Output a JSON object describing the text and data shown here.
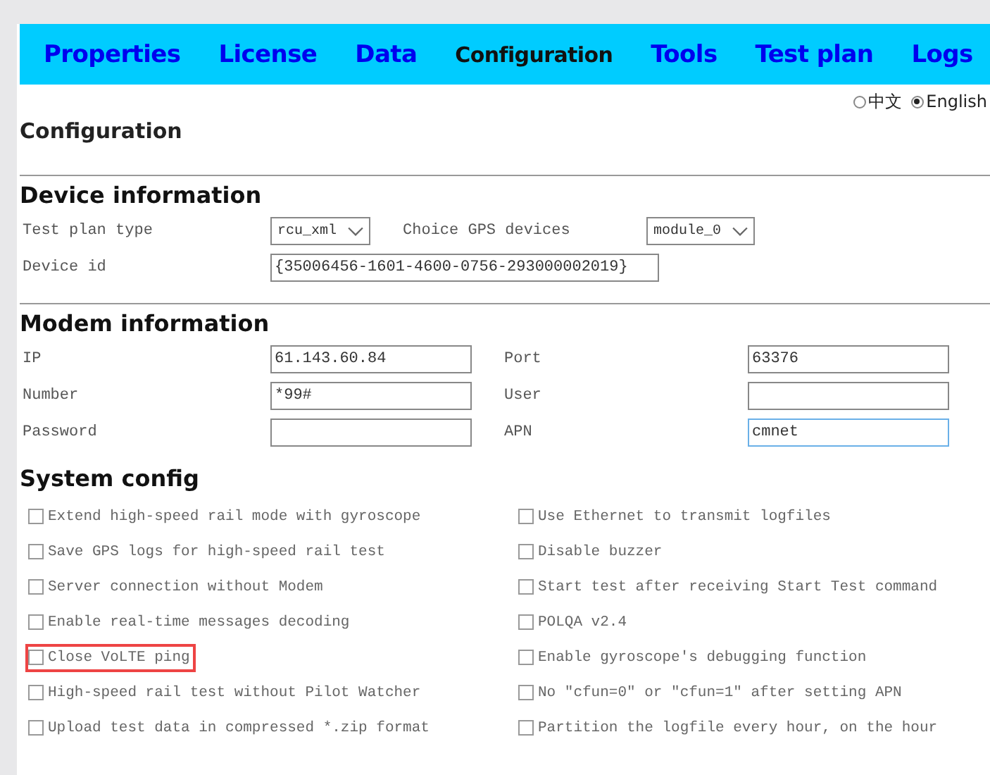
{
  "tabs": [
    {
      "label": "Properties",
      "selected": false
    },
    {
      "label": "License",
      "selected": false
    },
    {
      "label": "Data",
      "selected": false
    },
    {
      "label": "Configuration",
      "selected": true
    },
    {
      "label": "Tools",
      "selected": false
    },
    {
      "label": "Test plan",
      "selected": false
    },
    {
      "label": "Logs",
      "selected": false
    }
  ],
  "languages": [
    {
      "label": "中文",
      "selected": false
    },
    {
      "label": "English",
      "selected": true
    }
  ],
  "page_title": "Configuration",
  "sections": [
    {
      "title": "Device information",
      "rows": [
        [
          {
            "label": "Test plan type",
            "kind": "select",
            "value": "rcu_xml"
          },
          {
            "label": "Choice GPS devices",
            "kind": "select",
            "value": "module_0"
          }
        ],
        [
          {
            "label": "Device id",
            "kind": "wide",
            "value": "{35006456-1601-4600-0756-293000002019}"
          }
        ]
      ]
    },
    {
      "title": "Modem information",
      "rows": [
        [
          {
            "label": "IP",
            "kind": "input",
            "value": "61.143.60.84",
            "focused": false
          },
          {
            "label": "Port",
            "kind": "input",
            "value": "63376",
            "focused": false
          }
        ],
        [
          {
            "label": "Number",
            "kind": "input",
            "value": "*99#",
            "focused": false
          },
          {
            "label": "User",
            "kind": "input",
            "focused": false
          }
        ],
        [
          {
            "label": "Password",
            "kind": "input",
            "focused": false
          },
          {
            "label": "APN",
            "kind": "input",
            "value": "cmnet",
            "focused": true
          }
        ]
      ]
    }
  ],
  "system_config": {
    "title": "System config",
    "options": [
      {
        "label": "Extend high-speed rail mode with gyroscope",
        "checked": false,
        "highlighted": false
      },
      {
        "label": "Use Ethernet to transmit logfiles",
        "checked": false,
        "highlighted": false
      },
      {
        "label": "Save GPS logs for high-speed rail test",
        "checked": false,
        "highlighted": false
      },
      {
        "label": "Disable buzzer",
        "checked": false,
        "highlighted": false
      },
      {
        "label": "Server connection without Modem",
        "checked": false,
        "highlighted": false
      },
      {
        "label": "Start test after receiving Start Test command",
        "checked": false,
        "highlighted": false
      },
      {
        "label": "Enable real-time messages decoding",
        "checked": false,
        "highlighted": false
      },
      {
        "label": "POLQA v2.4",
        "checked": false,
        "highlighted": false
      },
      {
        "label": "Close VoLTE ping",
        "checked": false,
        "highlighted": true
      },
      {
        "label": "Enable gyroscope's debugging function",
        "checked": false,
        "highlighted": false
      },
      {
        "label": "High-speed rail test without Pilot Watcher",
        "checked": false,
        "highlighted": false
      },
      {
        "label": "No \"cfun=0\" or \"cfun=1\" after setting APN",
        "checked": false,
        "highlighted": false
      },
      {
        "label": "Upload test data in compressed *.zip format",
        "checked": false,
        "highlighted": false
      },
      {
        "label": "Partition the logfile every hour, on the hour",
        "checked": false,
        "highlighted": false
      }
    ]
  }
}
